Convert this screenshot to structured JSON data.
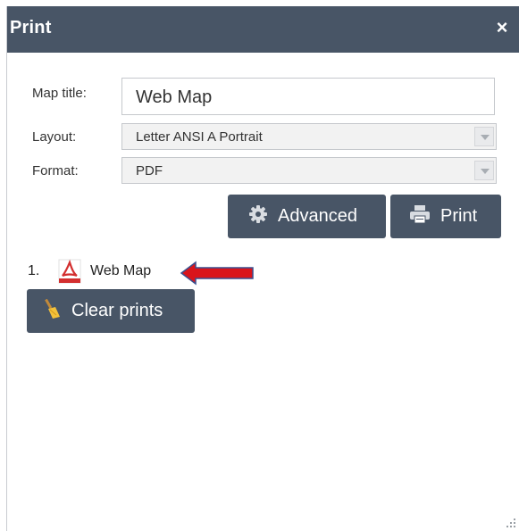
{
  "dialog": {
    "title": "Print",
    "close_glyph": "×"
  },
  "form": {
    "map_title_label": "Map title:",
    "map_title_value": "Web Map",
    "layout_label": "Layout:",
    "layout_value": "Letter ANSI A Portrait",
    "format_label": "Format:",
    "format_value": "PDF"
  },
  "buttons": {
    "advanced_label": "Advanced",
    "advanced_icon": "gear-icon",
    "print_label": "Print",
    "print_icon": "printer-icon",
    "clear_label": "Clear prints",
    "clear_icon": "broom-icon"
  },
  "results": [
    {
      "index": "1.",
      "icon": "pdf-icon",
      "name": "Web Map"
    }
  ],
  "colors": {
    "header_bg": "#485566",
    "button_bg": "#485566",
    "annotation_arrow": "#d9141b",
    "pdf_red": "#d32f2f"
  }
}
